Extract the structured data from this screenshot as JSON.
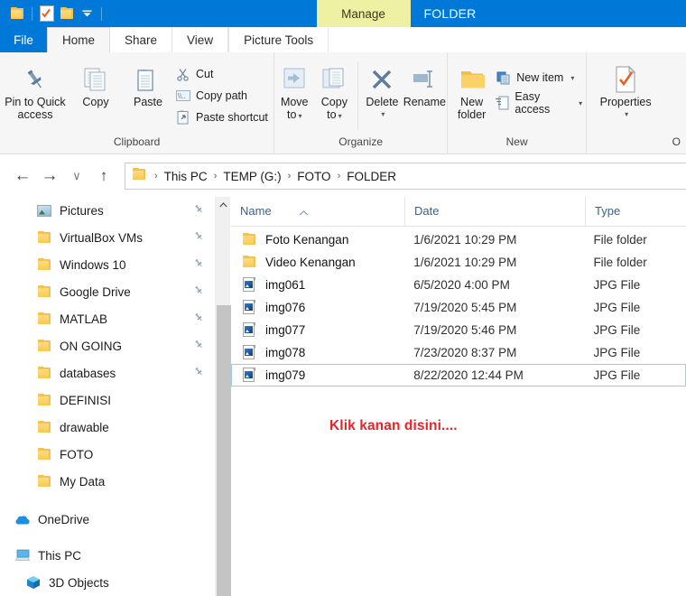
{
  "window": {
    "title": "FOLDER",
    "contextual_tab": "Manage",
    "quick_access": [
      "folder-icon",
      "properties-icon",
      "new-folder-icon",
      "customize-dropdown-icon"
    ]
  },
  "tabs": {
    "file": "File",
    "items": [
      {
        "label": "Home",
        "active": true
      },
      {
        "label": "Share",
        "active": false
      },
      {
        "label": "View",
        "active": false
      },
      {
        "label": "Picture Tools",
        "active": false,
        "contextual": true
      }
    ]
  },
  "ribbon": {
    "groups": [
      {
        "name": "Clipboard",
        "label": "Clipboard",
        "big_buttons": [
          {
            "label": "Pin to Quick\naccess",
            "line1": "Pin to Quick",
            "line2": "access",
            "icon": "pin-icon"
          },
          {
            "label": "Copy",
            "line1": "Copy",
            "line2": "",
            "icon": "copy-icon"
          },
          {
            "label": "Paste",
            "line1": "Paste",
            "line2": "",
            "icon": "paste-icon"
          }
        ],
        "small_buttons": [
          {
            "label": "Cut",
            "icon": "scissors-icon",
            "caret": false
          },
          {
            "label": "Copy path",
            "icon": "copy-path-icon",
            "caret": false
          },
          {
            "label": "Paste shortcut",
            "icon": "paste-shortcut-icon",
            "caret": false
          }
        ]
      },
      {
        "name": "Organize",
        "label": "Organize",
        "big_buttons": [
          {
            "line1": "Move",
            "line2": "to",
            "icon": "move-to-icon",
            "caret": true
          },
          {
            "line1": "Copy",
            "line2": "to",
            "icon": "copy-to-icon",
            "caret": true
          },
          {
            "line1": "Delete",
            "line2": "",
            "icon": "delete-icon",
            "caret": true
          },
          {
            "line1": "Rename",
            "line2": "",
            "icon": "rename-icon",
            "caret": false
          }
        ]
      },
      {
        "name": "New",
        "label": "New",
        "big_buttons": [
          {
            "line1": "New",
            "line2": "folder",
            "icon": "new-folder-icon",
            "caret": false
          }
        ],
        "small_buttons": [
          {
            "label": "New item",
            "icon": "new-item-icon",
            "caret": true
          },
          {
            "label": "Easy access",
            "icon": "easy-access-icon",
            "caret": true
          }
        ]
      },
      {
        "name": "Open",
        "label": "O",
        "big_buttons": [
          {
            "line1": "Properties",
            "line2": "",
            "icon": "properties-icon",
            "caret": true
          }
        ]
      }
    ]
  },
  "addressbar": {
    "back": "←",
    "forward": "→",
    "recent": "∨",
    "up": "↑",
    "breadcrumbs": [
      "This PC",
      "TEMP (G:)",
      "FOTO",
      "FOLDER"
    ],
    "separator": "›"
  },
  "sidebar": {
    "items": [
      {
        "label": "Pictures",
        "icon": "pictures-icon",
        "pinned": true,
        "indent": 1
      },
      {
        "label": "VirtualBox VMs",
        "icon": "folder-icon",
        "pinned": true,
        "indent": 1
      },
      {
        "label": "Windows 10",
        "icon": "folder-icon",
        "pinned": true,
        "indent": 1
      },
      {
        "label": "Google Drive",
        "icon": "folder-icon",
        "pinned": true,
        "indent": 1
      },
      {
        "label": "MATLAB",
        "icon": "folder-icon",
        "pinned": true,
        "indent": 1
      },
      {
        "label": "ON GOING",
        "icon": "folder-icon",
        "pinned": true,
        "indent": 1
      },
      {
        "label": "databases",
        "icon": "folder-icon",
        "pinned": true,
        "indent": 1
      },
      {
        "label": "DEFINISI",
        "icon": "folder-icon",
        "pinned": false,
        "indent": 1
      },
      {
        "label": "drawable",
        "icon": "folder-icon",
        "pinned": false,
        "indent": 1
      },
      {
        "label": "FOTO",
        "icon": "folder-icon",
        "pinned": false,
        "indent": 1
      },
      {
        "label": "My Data",
        "icon": "folder-icon",
        "pinned": false,
        "indent": 1
      },
      {
        "label": "OneDrive",
        "icon": "onedrive-icon",
        "pinned": false,
        "indent": 0
      },
      {
        "label": "This PC",
        "icon": "this-pc-icon",
        "pinned": false,
        "indent": 0
      },
      {
        "label": "3D Objects",
        "icon": "3d-objects-icon",
        "pinned": false,
        "indent": 1
      }
    ]
  },
  "filelist": {
    "columns": [
      {
        "label": "Name",
        "sorted": "asc"
      },
      {
        "label": "Date",
        "sorted": ""
      },
      {
        "label": "Type",
        "sorted": ""
      }
    ],
    "sort_arrow": "˄",
    "rows": [
      {
        "name": "Foto Kenangan",
        "date": "1/6/2021 10:29 PM",
        "type": "File folder",
        "icon": "folder-icon",
        "selected": false
      },
      {
        "name": "Video Kenangan",
        "date": "1/6/2021 10:29 PM",
        "type": "File folder",
        "icon": "folder-icon",
        "selected": false
      },
      {
        "name": "img061",
        "date": "6/5/2020 4:00 PM",
        "type": "JPG File",
        "icon": "jpg-file-icon",
        "selected": false
      },
      {
        "name": "img076",
        "date": "7/19/2020 5:45 PM",
        "type": "JPG File",
        "icon": "jpg-file-icon",
        "selected": false
      },
      {
        "name": "img077",
        "date": "7/19/2020 5:46 PM",
        "type": "JPG File",
        "icon": "jpg-file-icon",
        "selected": false
      },
      {
        "name": "img078",
        "date": "7/23/2020 8:37 PM",
        "type": "JPG File",
        "icon": "jpg-file-icon",
        "selected": false
      },
      {
        "name": "img079",
        "date": "8/22/2020 12:44 PM",
        "type": "JPG File",
        "icon": "jpg-file-icon",
        "selected": true
      }
    ]
  },
  "annotation": {
    "text": "Klik kanan disini....",
    "color": "#e8232a"
  },
  "colors": {
    "titlebar_blue": "#0078d7",
    "contextual_yellow": "#eef0a4",
    "ribbon_bg": "#f6f6f6",
    "selection_border": "#9ecbf0",
    "column_header_text": "#38628f",
    "folder_yellow": "#f2c14e"
  }
}
